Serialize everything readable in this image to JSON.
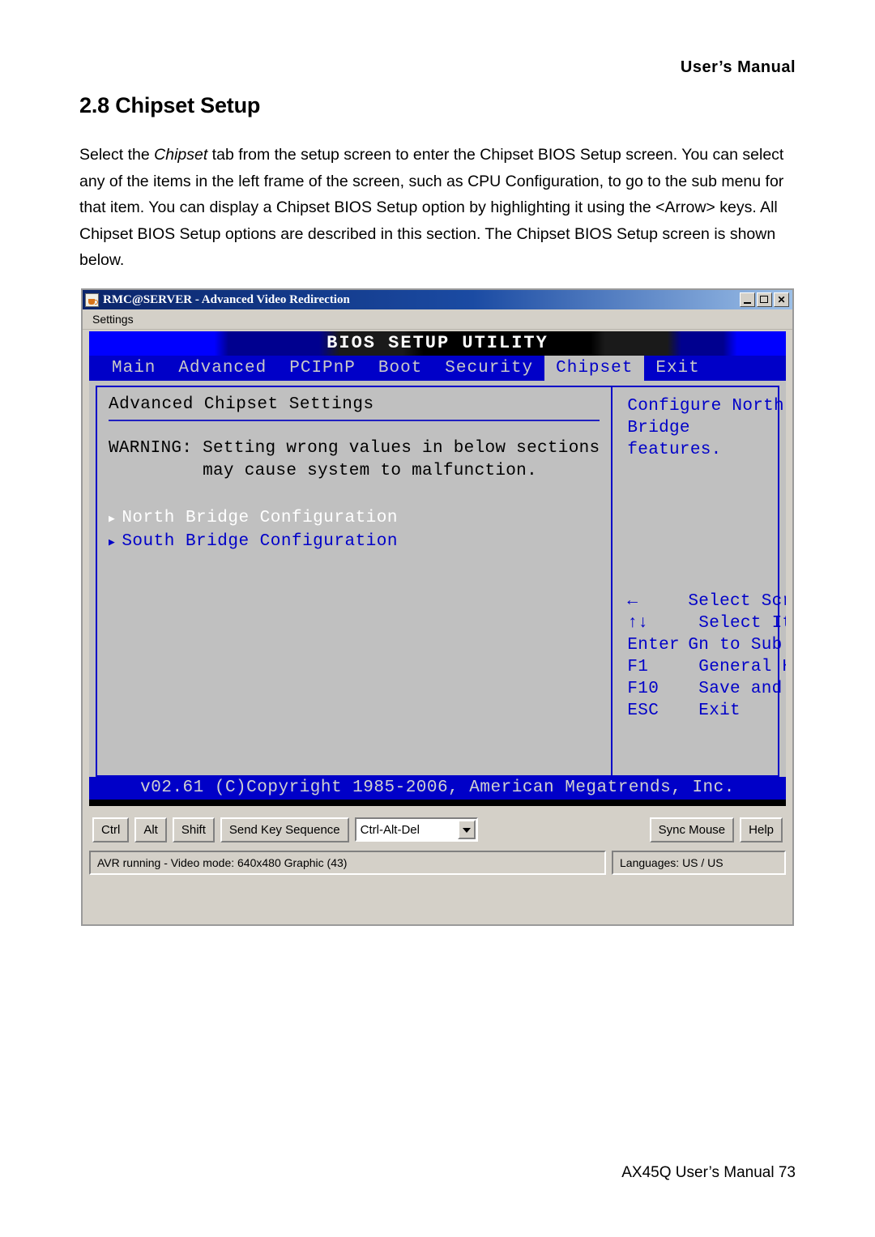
{
  "document": {
    "header": "User’s Manual",
    "section_number": "2.8",
    "section_title": "Chipset Setup",
    "body_part1": "Select the ",
    "body_italic": "Chipset",
    "body_part2": " tab from the setup screen to enter the Chipset BIOS Setup screen. You can select any of the items in the left frame of the screen, such as CPU Configuration, to go to the sub menu for that item. You can display a Chipset BIOS Setup option by highlighting it using the <Arrow> keys. All Chipset BIOS Setup options are described in this section. The Chipset BIOS Setup screen is shown below.",
    "footer": "AX45Q User’s Manual 73"
  },
  "window": {
    "title": "RMC@SERVER - Advanced Video Redirection",
    "icon": "java-coffee-cup-icon",
    "controls": {
      "minimize": "_",
      "maximize": "□",
      "close": "✕"
    },
    "menubar": {
      "settings": "Settings"
    }
  },
  "bios": {
    "banner_title": "BIOS SETUP UTILITY",
    "tabs": [
      {
        "label": "Main",
        "active": false
      },
      {
        "label": "Advanced",
        "active": false
      },
      {
        "label": "PCIPnP",
        "active": false
      },
      {
        "label": "Boot",
        "active": false
      },
      {
        "label": "Security",
        "active": false
      },
      {
        "label": "Chipset",
        "active": true
      },
      {
        "label": "Exit",
        "active": false
      }
    ],
    "left_panel": {
      "heading": "Advanced Chipset Settings",
      "warning_line1": "WARNING: Setting wrong values in below sections",
      "warning_line2": "         may cause system to malfunction.",
      "items": [
        {
          "label": "North Bridge Configuration",
          "selected": true
        },
        {
          "label": "South Bridge Configuration",
          "selected": false
        }
      ]
    },
    "right_panel": {
      "help_line1": "Configure North Bridge",
      "help_line2": "features.",
      "keys": [
        {
          "key": "←",
          "desc": "Select Screen"
        },
        {
          "key": "↑↓",
          "desc": " Select Item"
        },
        {
          "key": "Enter",
          "desc": "Gn to Sub Screen"
        },
        {
          "key": "F1",
          "desc": " General Help"
        },
        {
          "key": "F10",
          "desc": " Save and Exit"
        },
        {
          "key": "ESC",
          "desc": " Exit"
        }
      ]
    },
    "copyright": "v02.61 (C)Copyright 1985-2006, American Megatrends, Inc."
  },
  "toolbar": {
    "ctrl": "Ctrl",
    "alt": "Alt",
    "shift": "Shift",
    "send_key_sequence": "Send Key Sequence",
    "key_sequence_value": "Ctrl-Alt-Del",
    "sync_mouse": "Sync Mouse",
    "help": "Help"
  },
  "statusbar": {
    "left": "AVR running - Video mode: 640x480 Graphic (43)",
    "right": "Languages: US / US"
  },
  "colors": {
    "bios_blue": "#0000c8",
    "bios_gray": "#c0c0c0",
    "titlebar_blue": "#0a246a",
    "chrome_gray": "#d4d0c8"
  }
}
